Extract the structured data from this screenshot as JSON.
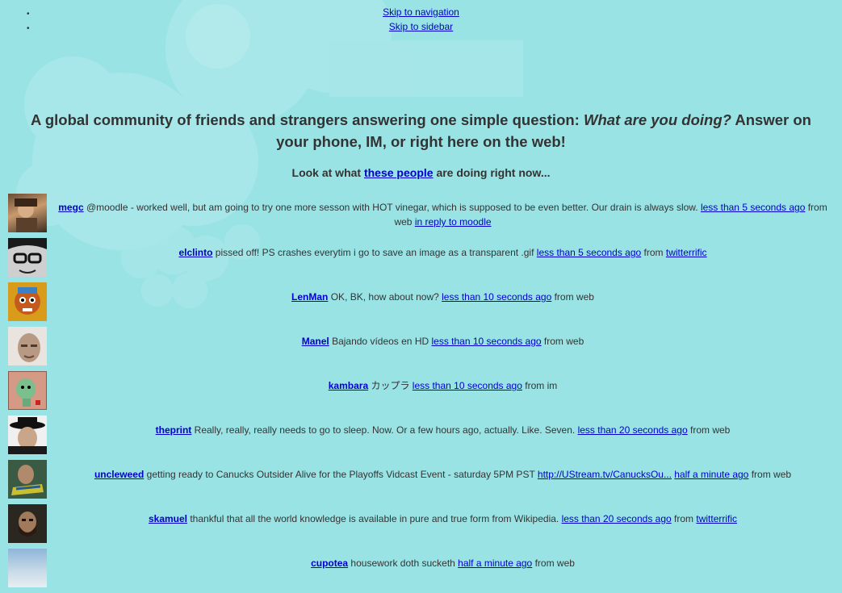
{
  "skip_links": [
    "Skip to navigation",
    "Skip to sidebar"
  ],
  "intro": {
    "part1": "A global community of friends and strangers answering one simple question: ",
    "question": "What are you doing?",
    "part2": " Answer on your phone, IM, or right here on the web!"
  },
  "lookat": {
    "prefix": "Look at what ",
    "link": "these people",
    "suffix": " are doing right now..."
  },
  "tweets": [
    {
      "user": "megc",
      "text": " @moodle - worked well, but am going to try one more sesson with HOT vinegar, which is supposed to be even better. Our drain is always slow. ",
      "time": "less than 5 seconds ago",
      "from": " from web ",
      "reply": "in reply to moodle",
      "source_link": ""
    },
    {
      "user": "elclinto",
      "text": " pissed off! PS crashes everytim i go to save an image as a transparent .gif ",
      "time": "less than 5 seconds ago",
      "from": " from ",
      "reply": "",
      "source_link": "twitterrific"
    },
    {
      "user": "LenMan",
      "text": " OK, BK, how about now? ",
      "time": "less than 10 seconds ago",
      "from": " from web",
      "reply": "",
      "source_link": ""
    },
    {
      "user": "Manel",
      "text": " Bajando vídeos en HD ",
      "time": "less than 10 seconds ago",
      "from": " from web",
      "reply": "",
      "source_link": ""
    },
    {
      "user": "kambara",
      "text": " カップラ ",
      "time": "less than 10 seconds ago",
      "from": " from im",
      "reply": "",
      "source_link": ""
    },
    {
      "user": "theprint",
      "text": " Really, really, really needs to go to sleep. Now. Or a few hours ago, actually. Like. Seven. ",
      "time": "less than 20 seconds ago",
      "from": " from web",
      "reply": "",
      "source_link": ""
    },
    {
      "user": "uncleweed",
      "text": " getting ready to Canucks Outsider Alive for the Playoffs Vidcast Event - saturday 5PM PST ",
      "link": "http://UStream.tv/CanucksOu...",
      "time": "half a minute ago",
      "from": " from web",
      "reply": "",
      "source_link": ""
    },
    {
      "user": "skamuel",
      "text": " thankful that all the world knowledge is available in pure and true form from Wikipedia. ",
      "time": "less than 20 seconds ago",
      "from": " from ",
      "reply": "",
      "source_link": "twitterrific"
    },
    {
      "user": "cupotea",
      "text": " housework doth sucketh ",
      "time": "half a minute ago",
      "from": " from web",
      "reply": "",
      "source_link": ""
    }
  ],
  "avatars": [
    "portrait-icon",
    "glasses-face-icon",
    "cartoon-icon",
    "face-icon",
    "green-cartoon-icon",
    "hat-man-icon",
    "scarf-man-icon",
    "bearded-man-icon",
    "sky-icon"
  ]
}
